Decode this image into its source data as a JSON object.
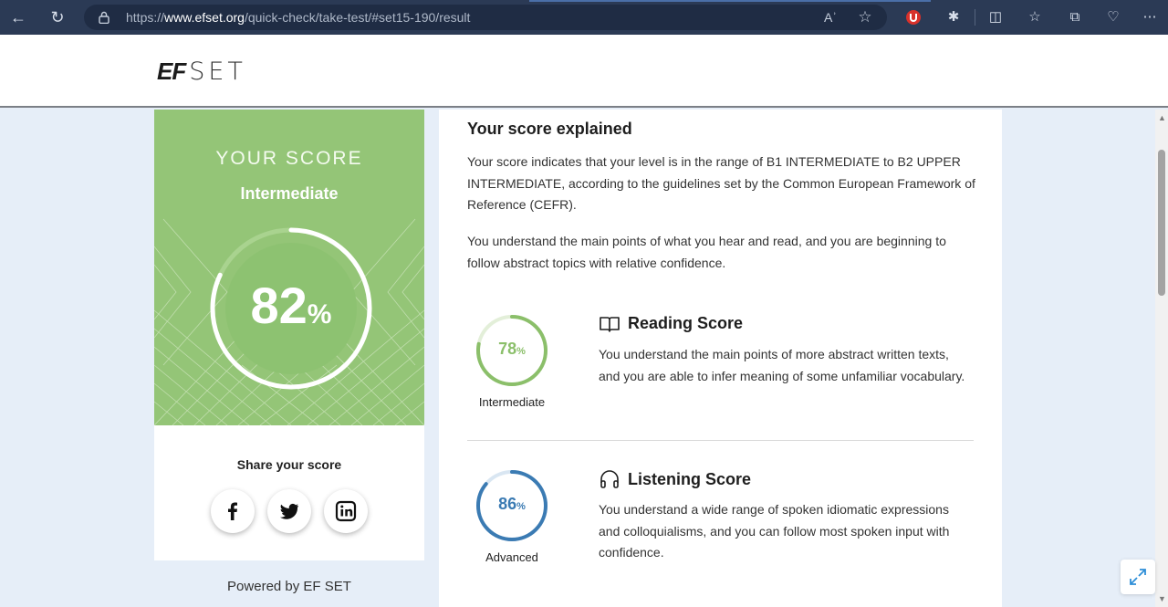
{
  "browser": {
    "url_prefix": "https://",
    "url_domain": "www.efset.org",
    "url_path": "/quick-check/take-test/#set15-190/result",
    "read_aloud_label": "Aʾ"
  },
  "header": {
    "logo_ef": "EF",
    "logo_set": "SET"
  },
  "score_card": {
    "label": "YOUR SCORE",
    "level": "Intermediate",
    "percent": 82,
    "percent_text": "82",
    "percent_sign": "%",
    "ring_color": "#ffffff",
    "background_color": "#94c577",
    "share_label": "Share your score",
    "social": [
      "facebook",
      "twitter",
      "linkedin"
    ]
  },
  "powered_by": "Powered by EF SET",
  "explanation": {
    "title": "Your score explained",
    "paragraph1": "Your score indicates that your level is in the range of B1 INTERMEDIATE to B2 UPPER INTERMEDIATE, according to the guidelines set by the Common European Framework of Reference (CEFR).",
    "paragraph2": "You understand the main points of what you hear and read, and you are beginning to follow abstract topics with relative confidence."
  },
  "reading": {
    "icon": "book-icon",
    "title": "Reading Score",
    "percent": 78,
    "percent_text": "78",
    "percent_sign": "%",
    "level": "Intermediate",
    "color": "#8bbf6a",
    "description": "You understand the main points of more abstract written texts, and you are able to infer meaning of some unfamiliar vocabulary."
  },
  "listening": {
    "icon": "headphones-icon",
    "title": "Listening Score",
    "percent": 86,
    "percent_text": "86",
    "percent_sign": "%",
    "level": "Advanced",
    "color": "#3b7bb3",
    "description": "You understand a wide range of spoken idiomatic expressions and colloquialisms, and you can follow most spoken input with confidence."
  }
}
